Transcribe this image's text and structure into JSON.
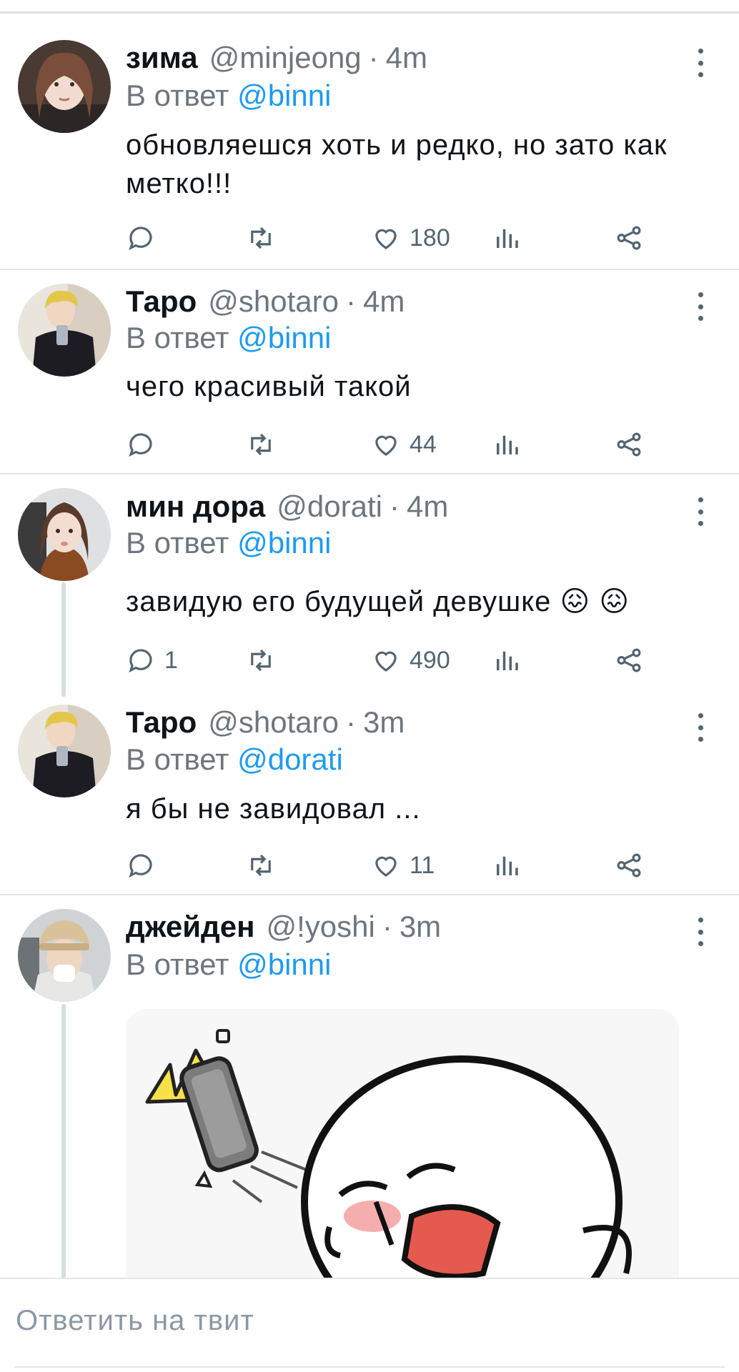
{
  "reply_prefix": "В ответ",
  "tweets": [
    {
      "name": "зима",
      "handle": "@minjeong",
      "time": "4m",
      "reply_to": "@binni",
      "text": "обновляешся хоть и редко, но зато как метко!!!",
      "replies": "",
      "likes": "180"
    },
    {
      "name": "Таро",
      "handle": "@shotaro",
      "time": "4m",
      "reply_to": "@binni",
      "text": "чего красивый такой",
      "replies": "",
      "likes": "44"
    },
    {
      "name": "мин дора",
      "handle": "@dorati",
      "time": "4m",
      "reply_to": "@binni",
      "text": "завидую его будущей девушке 😖 😖",
      "replies": "1",
      "likes": "490"
    },
    {
      "name": "Таро",
      "handle": "@shotaro",
      "time": "3m",
      "reply_to": "@dorati",
      "text": "я бы не завидовал ...",
      "replies": "",
      "likes": "11"
    },
    {
      "name": "джейден",
      "handle": "@!yoshi",
      "time": "3m",
      "reply_to": "@binni",
      "text": "",
      "replies": "",
      "likes": ""
    }
  ],
  "composer": {
    "placeholder": "Ответить на твит"
  },
  "colors": {
    "accent": "#1d9bf0",
    "muted": "#6e767d",
    "text": "#0f1419"
  }
}
